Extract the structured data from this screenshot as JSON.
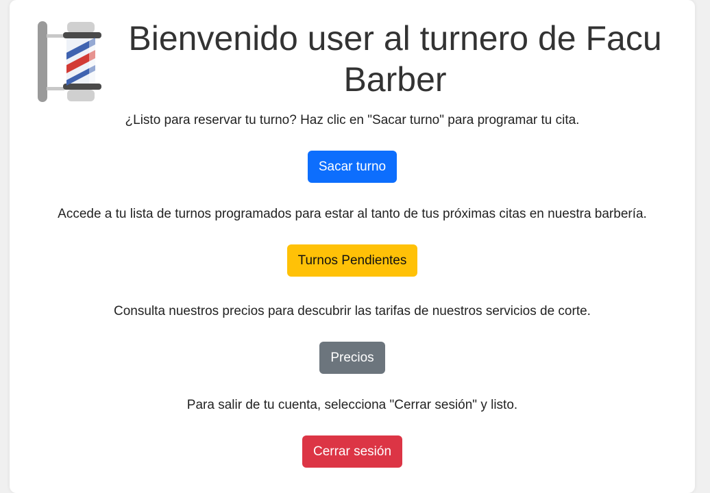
{
  "header": {
    "title": "Bienvenido user al turnero de Facu Barber",
    "logo_icon": "barber-pole-icon"
  },
  "sections": [
    {
      "text": "¿Listo para reservar tu turno? Haz clic en \"Sacar turno\" para programar tu cita.",
      "button_label": "Sacar turno",
      "button_color": "#0d6efd"
    },
    {
      "text": "Accede a tu lista de turnos programados para estar al tanto de tus próximas citas en nuestra barbería.",
      "button_label": "Turnos Pendientes",
      "button_color": "#ffc107"
    },
    {
      "text": "Consulta nuestros precios para descubrir las tarifas de nuestros servicios de corte.",
      "button_label": "Precios",
      "button_color": "#6c757d"
    },
    {
      "text": "Para salir de tu cuenta, selecciona \"Cerrar sesión\" y listo.",
      "button_label": "Cerrar sesión",
      "button_color": "#dc3545"
    }
  ]
}
